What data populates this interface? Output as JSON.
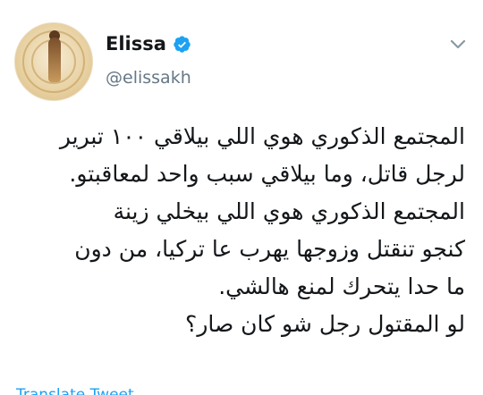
{
  "user": {
    "display_name": "Elissa",
    "handle": "@elissakh",
    "verified_icon": "verified-badge-icon",
    "verified_color": "#1da1f2"
  },
  "tweet": {
    "text": "المجتمع الذكوري هوي اللي بيلاقي ١٠٠ تبرير\nلرجل قاتل، وما بيلاقي سبب واحد لمعاقبتو.\nالمجتمع الذكوري هوي اللي بيخلي زينة\nكنجو تنقتل وزوجها يهرب عا تركيا، من دون\nما حدا يتحرك لمنع هالشي.\nلو المقتول رجل شو كان صار؟"
  },
  "actions": {
    "menu_icon": "chevron-down-icon",
    "translate_label": "Translate Tweet"
  },
  "colors": {
    "text": "#14171a",
    "secondary": "#657786",
    "link": "#1da1f2"
  }
}
